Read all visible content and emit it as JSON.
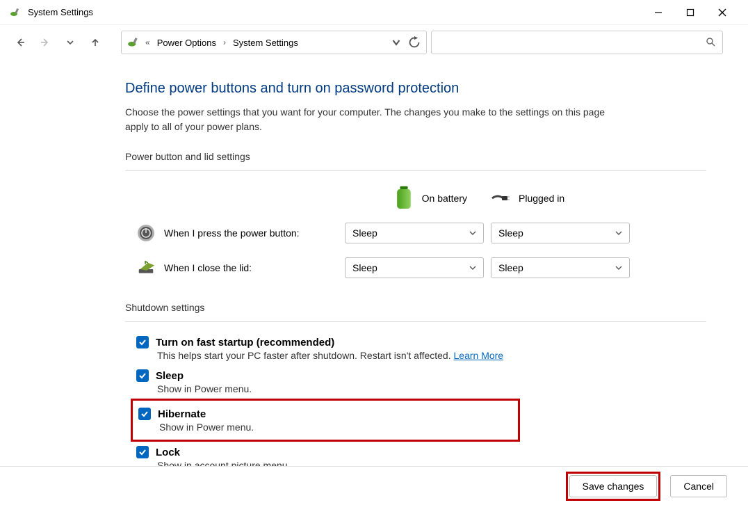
{
  "window": {
    "title": "System Settings"
  },
  "breadcrumb": {
    "item1": "Power Options",
    "item2": "System Settings"
  },
  "page": {
    "title": "Define power buttons and turn on password protection",
    "description": "Choose the power settings that you want for your computer. The changes you make to the settings on this page apply to all of your power plans."
  },
  "section1": {
    "heading": "Power button and lid settings",
    "col_battery": "On battery",
    "col_plugged": "Plugged in",
    "row_power_label": "When I press the power button:",
    "row_lid_label": "When I close the lid:",
    "sel_power_battery": "Sleep",
    "sel_power_plugged": "Sleep",
    "sel_lid_battery": "Sleep",
    "sel_lid_plugged": "Sleep"
  },
  "section2": {
    "heading": "Shutdown settings",
    "fast_title": "Turn on fast startup (recommended)",
    "fast_desc": "This helps start your PC faster after shutdown. Restart isn't affected. ",
    "fast_learn": "Learn More",
    "sleep_title": "Sleep",
    "sleep_desc": "Show in Power menu.",
    "hibernate_title": "Hibernate",
    "hibernate_desc": "Show in Power menu.",
    "lock_title": "Lock",
    "lock_desc": "Show in account picture menu."
  },
  "footer": {
    "save": "Save changes",
    "cancel": "Cancel"
  }
}
